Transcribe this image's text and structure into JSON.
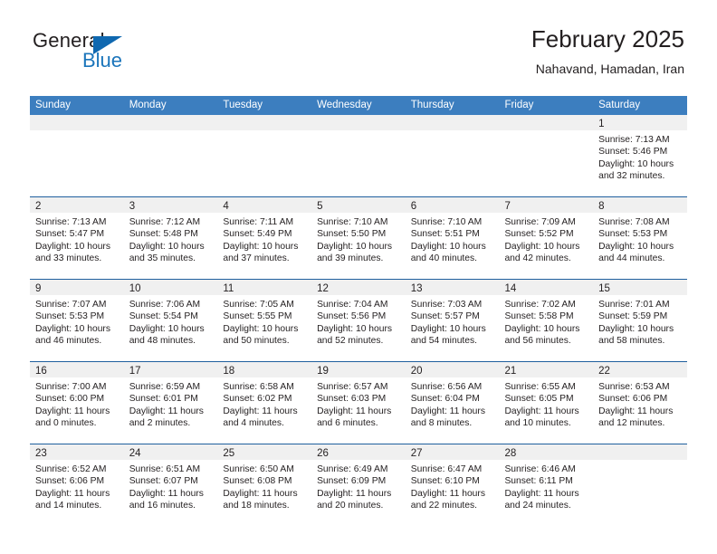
{
  "branding": {
    "logo_primary": "General",
    "logo_secondary": "Blue"
  },
  "header": {
    "title": "February 2025",
    "subtitle": "Nahavand, Hamadan, Iran"
  },
  "colors": {
    "header_blue": "#3c7ebf",
    "row_divider_blue": "#1f5f9e",
    "day_strip_gray": "#f0f0f0",
    "logo_blue": "#1b75bb",
    "text": "#231f20"
  },
  "weekdays": [
    "Sunday",
    "Monday",
    "Tuesday",
    "Wednesday",
    "Thursday",
    "Friday",
    "Saturday"
  ],
  "weeks": [
    [
      {
        "day": "",
        "lines": []
      },
      {
        "day": "",
        "lines": []
      },
      {
        "day": "",
        "lines": []
      },
      {
        "day": "",
        "lines": []
      },
      {
        "day": "",
        "lines": []
      },
      {
        "day": "",
        "lines": []
      },
      {
        "day": "1",
        "lines": [
          "Sunrise: 7:13 AM",
          "Sunset: 5:46 PM",
          "Daylight: 10 hours",
          "and 32 minutes."
        ]
      }
    ],
    [
      {
        "day": "2",
        "lines": [
          "Sunrise: 7:13 AM",
          "Sunset: 5:47 PM",
          "Daylight: 10 hours",
          "and 33 minutes."
        ]
      },
      {
        "day": "3",
        "lines": [
          "Sunrise: 7:12 AM",
          "Sunset: 5:48 PM",
          "Daylight: 10 hours",
          "and 35 minutes."
        ]
      },
      {
        "day": "4",
        "lines": [
          "Sunrise: 7:11 AM",
          "Sunset: 5:49 PM",
          "Daylight: 10 hours",
          "and 37 minutes."
        ]
      },
      {
        "day": "5",
        "lines": [
          "Sunrise: 7:10 AM",
          "Sunset: 5:50 PM",
          "Daylight: 10 hours",
          "and 39 minutes."
        ]
      },
      {
        "day": "6",
        "lines": [
          "Sunrise: 7:10 AM",
          "Sunset: 5:51 PM",
          "Daylight: 10 hours",
          "and 40 minutes."
        ]
      },
      {
        "day": "7",
        "lines": [
          "Sunrise: 7:09 AM",
          "Sunset: 5:52 PM",
          "Daylight: 10 hours",
          "and 42 minutes."
        ]
      },
      {
        "day": "8",
        "lines": [
          "Sunrise: 7:08 AM",
          "Sunset: 5:53 PM",
          "Daylight: 10 hours",
          "and 44 minutes."
        ]
      }
    ],
    [
      {
        "day": "9",
        "lines": [
          "Sunrise: 7:07 AM",
          "Sunset: 5:53 PM",
          "Daylight: 10 hours",
          "and 46 minutes."
        ]
      },
      {
        "day": "10",
        "lines": [
          "Sunrise: 7:06 AM",
          "Sunset: 5:54 PM",
          "Daylight: 10 hours",
          "and 48 minutes."
        ]
      },
      {
        "day": "11",
        "lines": [
          "Sunrise: 7:05 AM",
          "Sunset: 5:55 PM",
          "Daylight: 10 hours",
          "and 50 minutes."
        ]
      },
      {
        "day": "12",
        "lines": [
          "Sunrise: 7:04 AM",
          "Sunset: 5:56 PM",
          "Daylight: 10 hours",
          "and 52 minutes."
        ]
      },
      {
        "day": "13",
        "lines": [
          "Sunrise: 7:03 AM",
          "Sunset: 5:57 PM",
          "Daylight: 10 hours",
          "and 54 minutes."
        ]
      },
      {
        "day": "14",
        "lines": [
          "Sunrise: 7:02 AM",
          "Sunset: 5:58 PM",
          "Daylight: 10 hours",
          "and 56 minutes."
        ]
      },
      {
        "day": "15",
        "lines": [
          "Sunrise: 7:01 AM",
          "Sunset: 5:59 PM",
          "Daylight: 10 hours",
          "and 58 minutes."
        ]
      }
    ],
    [
      {
        "day": "16",
        "lines": [
          "Sunrise: 7:00 AM",
          "Sunset: 6:00 PM",
          "Daylight: 11 hours",
          "and 0 minutes."
        ]
      },
      {
        "day": "17",
        "lines": [
          "Sunrise: 6:59 AM",
          "Sunset: 6:01 PM",
          "Daylight: 11 hours",
          "and 2 minutes."
        ]
      },
      {
        "day": "18",
        "lines": [
          "Sunrise: 6:58 AM",
          "Sunset: 6:02 PM",
          "Daylight: 11 hours",
          "and 4 minutes."
        ]
      },
      {
        "day": "19",
        "lines": [
          "Sunrise: 6:57 AM",
          "Sunset: 6:03 PM",
          "Daylight: 11 hours",
          "and 6 minutes."
        ]
      },
      {
        "day": "20",
        "lines": [
          "Sunrise: 6:56 AM",
          "Sunset: 6:04 PM",
          "Daylight: 11 hours",
          "and 8 minutes."
        ]
      },
      {
        "day": "21",
        "lines": [
          "Sunrise: 6:55 AM",
          "Sunset: 6:05 PM",
          "Daylight: 11 hours",
          "and 10 minutes."
        ]
      },
      {
        "day": "22",
        "lines": [
          "Sunrise: 6:53 AM",
          "Sunset: 6:06 PM",
          "Daylight: 11 hours",
          "and 12 minutes."
        ]
      }
    ],
    [
      {
        "day": "23",
        "lines": [
          "Sunrise: 6:52 AM",
          "Sunset: 6:06 PM",
          "Daylight: 11 hours",
          "and 14 minutes."
        ]
      },
      {
        "day": "24",
        "lines": [
          "Sunrise: 6:51 AM",
          "Sunset: 6:07 PM",
          "Daylight: 11 hours",
          "and 16 minutes."
        ]
      },
      {
        "day": "25",
        "lines": [
          "Sunrise: 6:50 AM",
          "Sunset: 6:08 PM",
          "Daylight: 11 hours",
          "and 18 minutes."
        ]
      },
      {
        "day": "26",
        "lines": [
          "Sunrise: 6:49 AM",
          "Sunset: 6:09 PM",
          "Daylight: 11 hours",
          "and 20 minutes."
        ]
      },
      {
        "day": "27",
        "lines": [
          "Sunrise: 6:47 AM",
          "Sunset: 6:10 PM",
          "Daylight: 11 hours",
          "and 22 minutes."
        ]
      },
      {
        "day": "28",
        "lines": [
          "Sunrise: 6:46 AM",
          "Sunset: 6:11 PM",
          "Daylight: 11 hours",
          "and 24 minutes."
        ]
      },
      {
        "day": "",
        "lines": []
      }
    ]
  ]
}
